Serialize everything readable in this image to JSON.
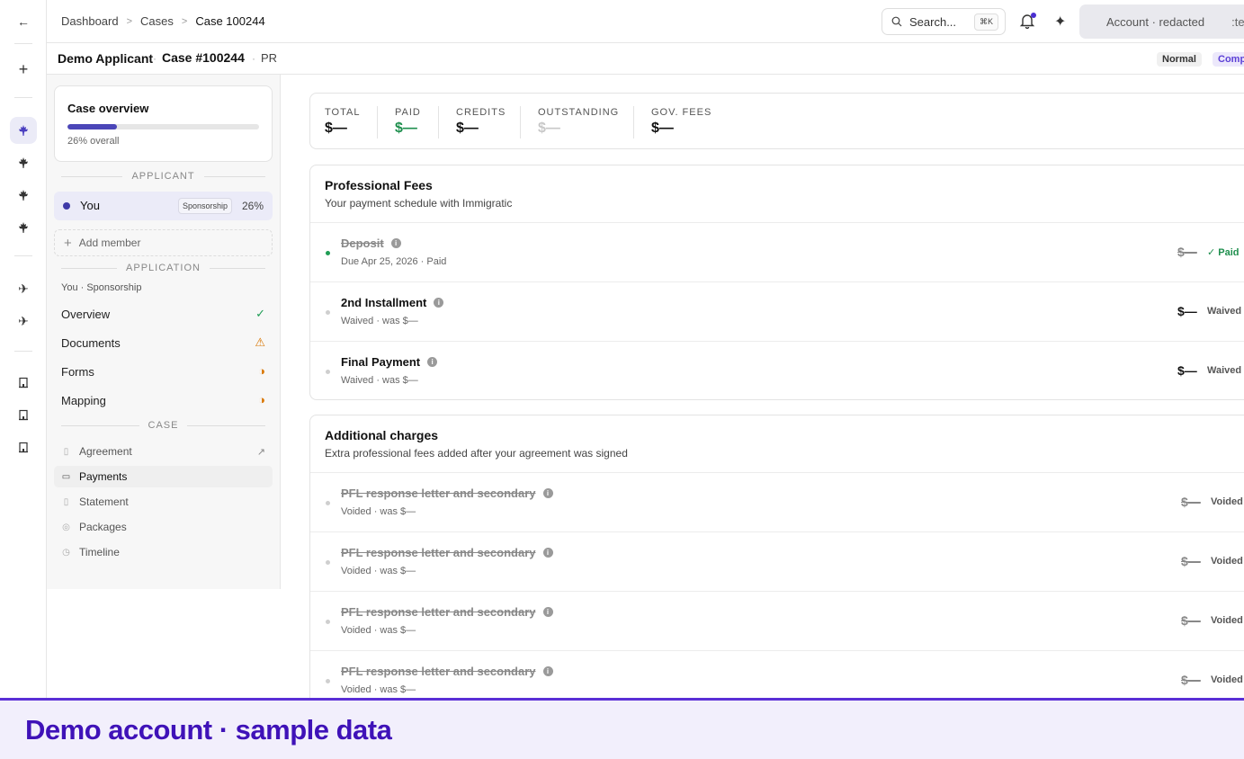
{
  "rail": {
    "icons": [
      "back-arrow-icon",
      "plus-icon",
      "maple-leaf-icon",
      "maple-leaf-icon",
      "maple-leaf-icon",
      "maple-leaf-icon",
      "airplane-icon",
      "airplane-icon",
      "building-icon",
      "building-icon",
      "building-icon"
    ]
  },
  "topbar": {
    "breadcrumbs": [
      "Dashboard",
      "Cases",
      "Case 100244"
    ],
    "search_placeholder": "Search...",
    "search_shortcut": "⌘K",
    "account_label": "Account · redacted",
    "account_trail": ":te"
  },
  "case_header": {
    "applicant": "Demo Applicant",
    "case_number": "Case #100244",
    "case_type": "PR",
    "priority": "Normal",
    "status_partial": "Comp"
  },
  "sidebar": {
    "overview": {
      "title": "Case overview",
      "progress_fraction": 0.26,
      "progress_label": "26% overall"
    },
    "applicant_section": "APPLICANT",
    "applicant": {
      "name": "You",
      "badge": "Sponsorship",
      "percent": "26%"
    },
    "add_member": "Add member",
    "application_section": "APPLICATION",
    "application_sub": "You · Sponsorship",
    "application_items": [
      {
        "label": "Overview",
        "status_icon": "check-icon",
        "color": "#1f9d55"
      },
      {
        "label": "Documents",
        "status_icon": "warning-icon",
        "color": "#d97706"
      },
      {
        "label": "Forms",
        "status_icon": "half-circle-icon",
        "color": "#d97706"
      },
      {
        "label": "Mapping",
        "status_icon": "half-circle-icon",
        "color": "#d97706"
      }
    ],
    "case_section": "CASE",
    "case_items": [
      {
        "label": "Agreement"
      },
      {
        "label": "Payments"
      },
      {
        "label": "Statement"
      },
      {
        "label": "Packages"
      },
      {
        "label": "Timeline"
      }
    ]
  },
  "summary": {
    "items": [
      {
        "label": "TOTAL",
        "value": "$—"
      },
      {
        "label": "PAID",
        "value": "$—",
        "color": "#1f8f4e"
      },
      {
        "label": "CREDITS",
        "value": "$—"
      },
      {
        "label": "OUTSTANDING",
        "value": "$—",
        "color": "#c8c8c8"
      },
      {
        "label": "GOV. FEES",
        "value": "$—"
      }
    ]
  },
  "professional_fees": {
    "title": "Professional Fees",
    "subtitle": "Your payment schedule with Immigratic",
    "rows": [
      {
        "name": "Deposit",
        "sub": "Due Apr 25, 2026 · Paid",
        "amount": "$—",
        "status": "✓ Paid"
      },
      {
        "name": "2nd Installment",
        "sub": "Waived · was $—",
        "amount": "$—",
        "status": "Waived"
      },
      {
        "name": "Final Payment",
        "sub": "Waived · was $—",
        "amount": "$—",
        "status": "Waived"
      }
    ]
  },
  "additional_charges": {
    "title": "Additional charges",
    "subtitle": "Extra professional fees added after your agreement was signed",
    "rows": [
      {
        "name": "PFL response letter and secondary",
        "sub": "Voided · was $—",
        "amount": "$—",
        "status": "Voided"
      },
      {
        "name": "PFL response letter and secondary",
        "sub": "Voided · was $—",
        "amount": "$—",
        "status": "Voided"
      },
      {
        "name": "PFL response letter and secondary",
        "sub": "Voided · was $—",
        "amount": "$—",
        "status": "Voided"
      },
      {
        "name": "PFL response letter and secondary",
        "sub": "Voided · was $—",
        "amount": "$—",
        "status": "Voided"
      }
    ]
  },
  "banner": {
    "text": "Demo account · sample data"
  },
  "colors": {
    "accent": "#4b46b8",
    "banner_text": "#3f12b8",
    "paid_green": "#1f8f4e"
  }
}
